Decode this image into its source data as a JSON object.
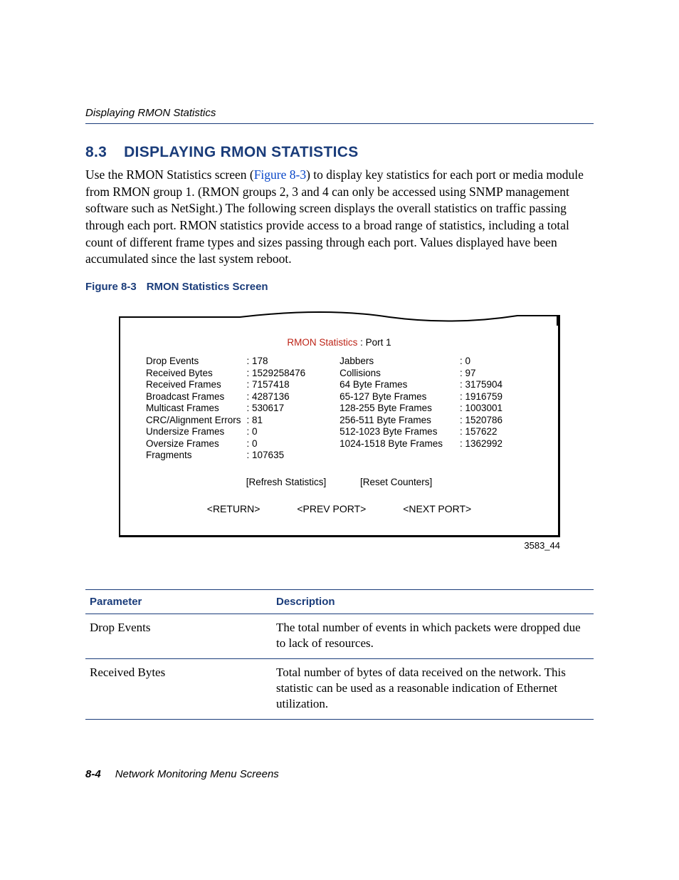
{
  "header": {
    "running": "Displaying RMON Statistics"
  },
  "section": {
    "number": "8.3",
    "title": "DISPLAYING RMON STATISTICS",
    "para_pre": "Use the RMON Statistics screen (",
    "fig_link": "Figure 8-3",
    "para_post": ") to display key statistics for each port or media module from RMON group 1. (RMON groups 2, 3 and 4 can only be accessed using SNMP management software such as NetSight.) The following screen displays the overall statistics on traffic passing through each port. RMON statistics provide access to a broad range of statistics, including a total count of different frame types and sizes passing through each port. Values displayed have been accumulated since the last system reboot."
  },
  "figure": {
    "caption_label": "Figure 8-3",
    "caption_text": "RMON Statistics Screen",
    "id": "3583_44",
    "screen": {
      "title_label": "RMON Statistics",
      "title_suffix": " : Port   1",
      "left_labels": "Drop Events\nReceived Bytes\nReceived Frames\nBroadcast Frames\nMulticast Frames\nCRC/Alignment Errors\nUndersize Frames\nOversize Frames\nFragments",
      "left_values": ": 178\n: 1529258476\n: 7157418\n: 4287136\n: 530617\n: 81\n: 0\n: 0\n: 107635",
      "right_labels": "Jabbers\nCollisions\n64 Byte Frames\n65-127 Byte Frames\n128-255 Byte Frames\n256-511 Byte Frames\n512-1023 Byte Frames\n1024-1518 Byte Frames",
      "right_values": ": 0\n: 97\n: 3175904\n: 1916759\n: 1003001\n: 1520786\n: 157622\n: 1362992",
      "refresh": "[Refresh Statistics]",
      "reset": "[Reset Counters]",
      "return": "<RETURN>",
      "prev": "<PREV PORT>",
      "next": "<NEXT PORT>"
    }
  },
  "table": {
    "h_param": "Parameter",
    "h_desc": "Description",
    "rows": [
      {
        "param": "Drop Events",
        "desc": "The total number of events in which packets were dropped due to lack of resources."
      },
      {
        "param": "Received Bytes",
        "desc": "Total number of bytes of data received on the network. This statistic can be used as a reasonable indication of Ethernet utilization."
      }
    ]
  },
  "footer": {
    "page": "8-4",
    "title": "Network Monitoring Menu Screens"
  }
}
